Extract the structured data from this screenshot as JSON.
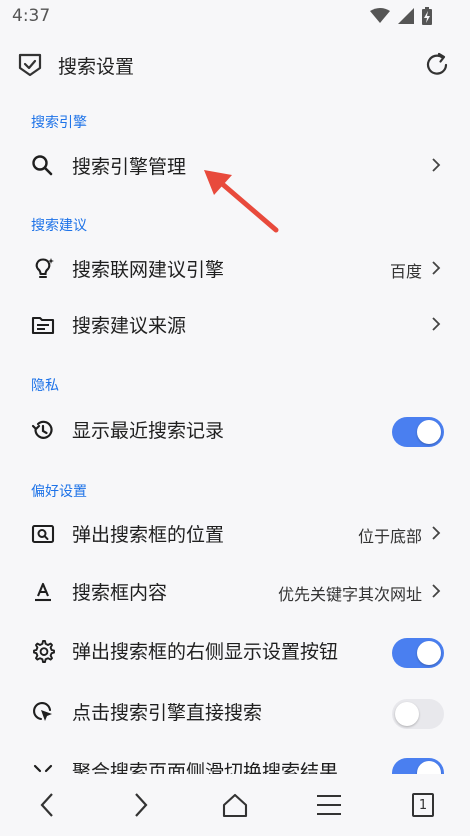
{
  "status_bar": {
    "time": "4:37"
  },
  "header": {
    "title": "搜索设置"
  },
  "sections": {
    "engine": {
      "title": "搜索引擎"
    },
    "suggest": {
      "title": "搜索建议"
    },
    "privacy": {
      "title": "隐私"
    },
    "prefs": {
      "title": "偏好设置"
    }
  },
  "rows": {
    "engine_manage": {
      "label": "搜索引擎管理"
    },
    "online_suggest_engine": {
      "label": "搜索联网建议引擎",
      "value": "百度"
    },
    "suggest_source": {
      "label": "搜索建议来源"
    },
    "show_recent": {
      "label": "显示最近搜索记录",
      "toggle": true
    },
    "popup_position": {
      "label": "弹出搜索框的位置",
      "value": "位于底部"
    },
    "box_content": {
      "label": "搜索框内容",
      "value": "优先关键字其次网址"
    },
    "popup_settings_btn": {
      "label": "弹出搜索框的右侧显示设置按钮",
      "toggle": true
    },
    "click_engine_search": {
      "label": "点击搜索引擎直接搜索",
      "toggle": false
    },
    "aggregate_swipe": {
      "label": "聚合搜索页面侧滑切换搜索结果",
      "toggle": true
    }
  },
  "bottom_nav": {
    "tabs_count": "1"
  },
  "colors": {
    "accent": "#1e73e8",
    "toggle_on": "#4a7ff0",
    "annotation": "#e84a3c"
  }
}
